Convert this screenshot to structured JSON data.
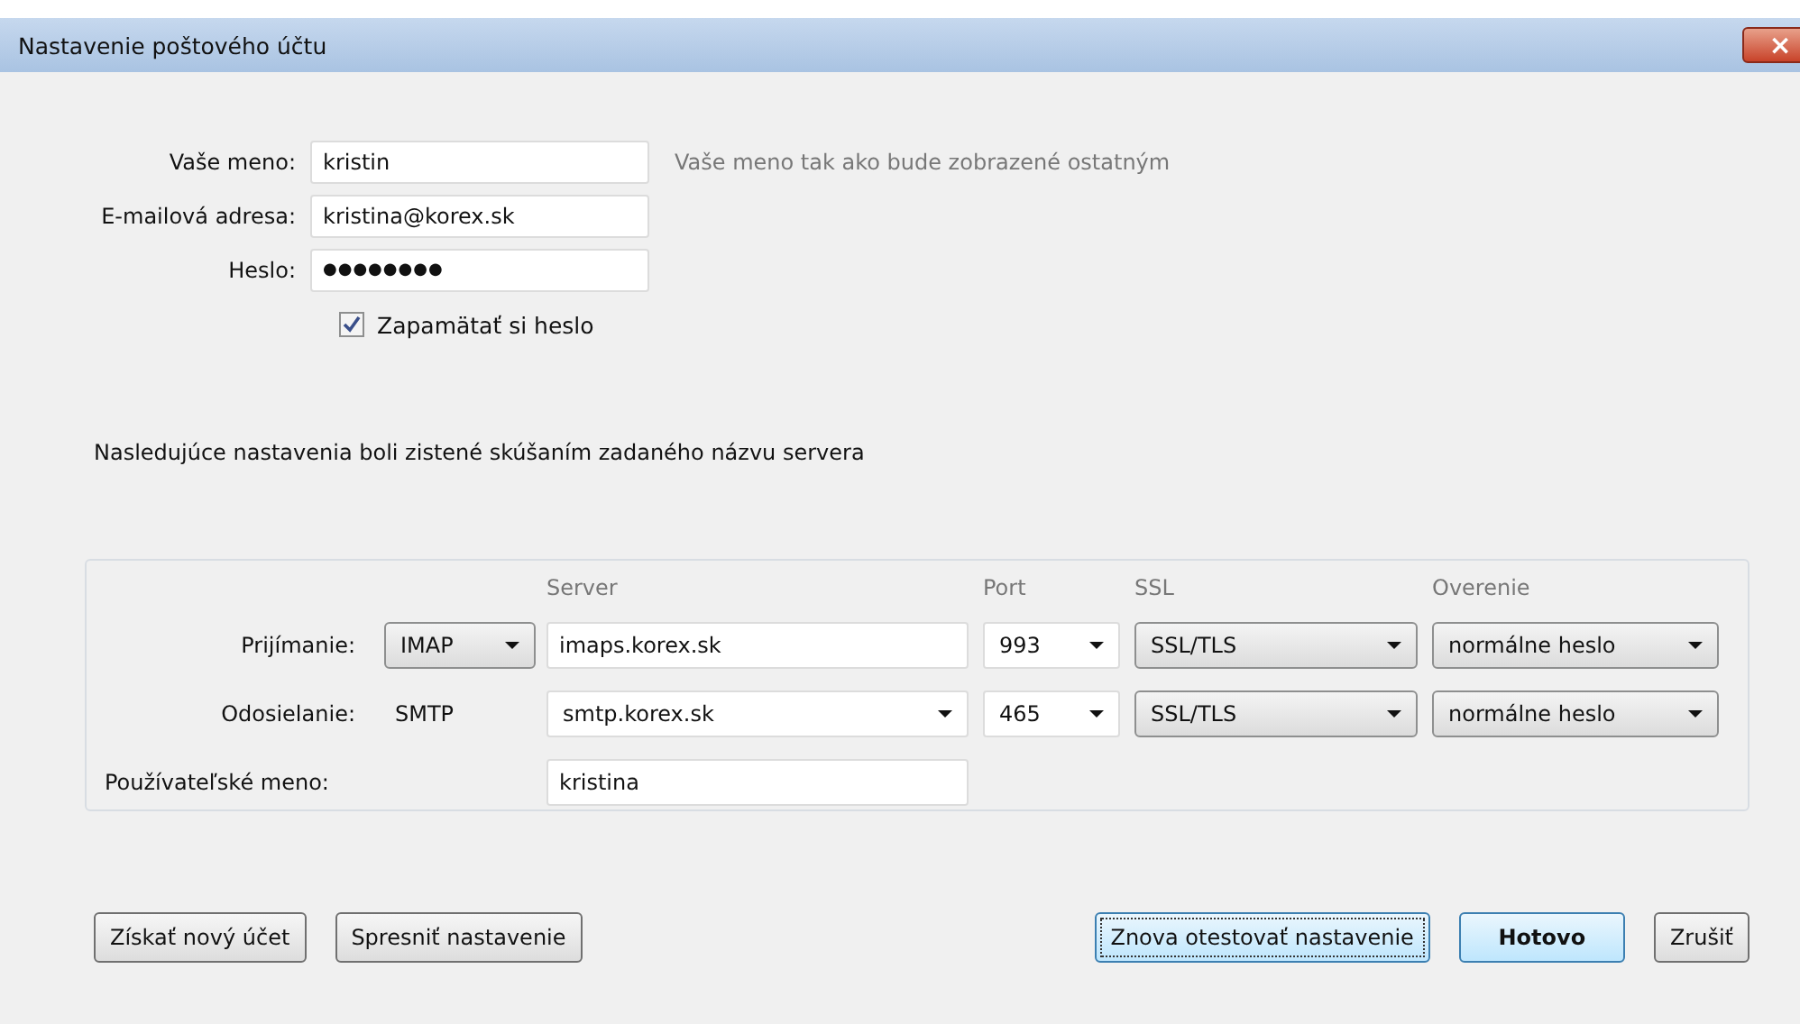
{
  "window": {
    "title": "Nastavenie poštového účtu",
    "close": "×"
  },
  "identity": [
    {
      "label": "Vaše meno:",
      "value": "kristin",
      "kind": "text",
      "hint": "Vaše meno tak ako bude zobrazené ostatným"
    },
    {
      "label": "E-mailová adresa:",
      "value": "kristina@korex.sk",
      "kind": "text"
    },
    {
      "label": "Heslo:",
      "value": "●●●●●●●●",
      "kind": "password"
    }
  ],
  "remember_password": {
    "label": "Zapamätať si heslo",
    "checked": true
  },
  "info": "Nasledujúce nastavenia boli zistené skúšaním zadaného názvu servera",
  "servers": {
    "columns": [
      "Server",
      "Port",
      "SSL",
      "Overenie"
    ],
    "rows": [
      {
        "label": "Prijímanie:",
        "protocol": {
          "text": "IMAP",
          "kind": "dropdown"
        },
        "server": {
          "text": "imaps.korex.sk",
          "kind": "field"
        },
        "port": "993",
        "ssl": "SSL/TLS",
        "auth": "normálne heslo"
      },
      {
        "label": "Odosielanie:",
        "protocol": {
          "text": "SMTP",
          "kind": "label"
        },
        "server": {
          "text": "smtp.korex.sk",
          "kind": "dropdown"
        },
        "port": "465",
        "ssl": "SSL/TLS",
        "auth": "normálne heslo"
      }
    ],
    "username": {
      "label": "Používateľské meno:",
      "value": "kristina"
    }
  },
  "buttons_left": [
    {
      "label": "Získať nový účet",
      "kind": "normal"
    },
    {
      "label": "Spresniť nastavenie",
      "kind": "normal"
    }
  ],
  "buttons_right": [
    {
      "label": "Znova otestovať nastavenie",
      "kind": "focused"
    },
    {
      "label": "Hotovo",
      "kind": "default"
    },
    {
      "label": "Zrušiť",
      "kind": "normal"
    }
  ]
}
